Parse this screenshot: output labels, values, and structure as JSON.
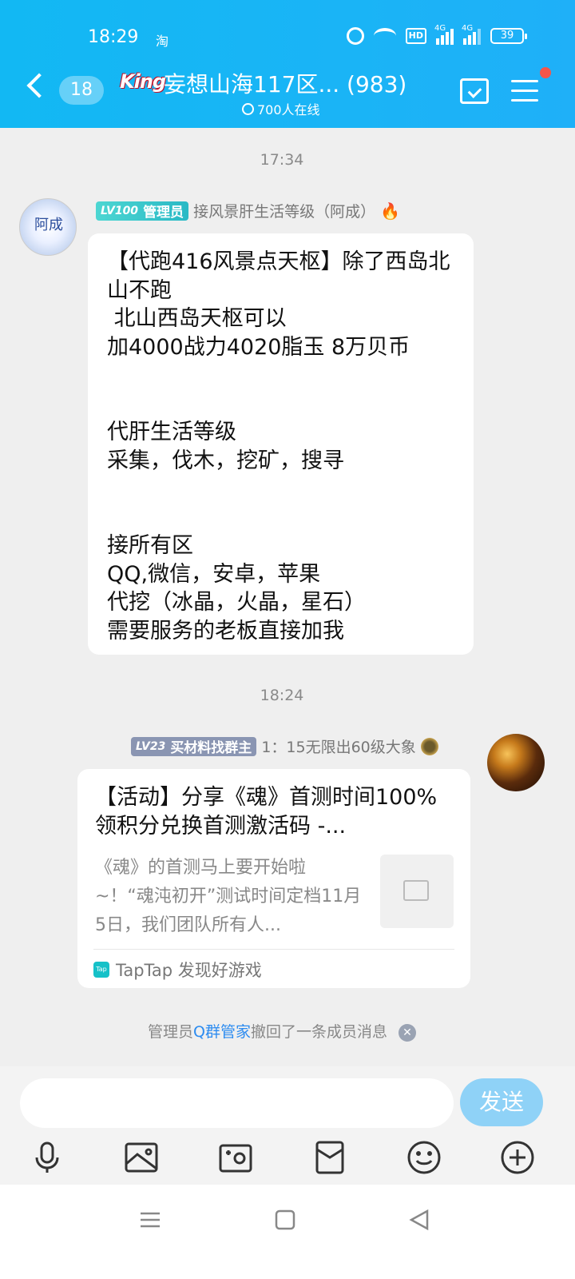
{
  "status_bar": {
    "time": "18:29",
    "app_indicator": "淘",
    "hd": "HD",
    "net1": "4G",
    "net2": "4G",
    "battery": "39"
  },
  "header": {
    "unread_count": "18",
    "king_badge": "King",
    "title": "妄想山海117区... (983)",
    "online": "700人在线"
  },
  "messages": [
    {
      "timestamp": "17:34",
      "level": "LV100",
      "role": "管理员",
      "name": "接风景肝生活等级（阿成）",
      "text": "【代跑416风景点天枢】除了西岛北山不跑\n 北山西岛天枢可以\n加4000战力4020脂玉 8万贝币\n\n\n代肝生活等级\n采集，伐木，挖矿，搜寻\n\n\n接所有区\nQQ,微信，安卓，苹果\n代挖（冰晶，火晶，星石）\n需要服务的老板直接加我"
    },
    {
      "timestamp": "18:24",
      "level": "LV23",
      "role": "买材料找群主",
      "name": "1：15无限出60级大象",
      "card": {
        "title": "【活动】分享《魂》首测时间100%领积分兑换首测激活码 -...",
        "description": "《魂》的首测马上要开始啦~！“魂沌初开”测试时间定档11月5日，我们团队所有人...",
        "source_logo": "Tap",
        "source": "TapTap 发现好游戏"
      }
    }
  ],
  "system_message": {
    "prefix": "管理员",
    "link": "Q群管家",
    "suffix": "撤回了一条成员消息"
  },
  "input": {
    "placeholder": "",
    "send_label": "发送"
  },
  "toolbar_icons": [
    "microphone-icon",
    "image-icon",
    "camera-icon",
    "red-packet-icon",
    "emoji-icon",
    "plus-icon"
  ]
}
